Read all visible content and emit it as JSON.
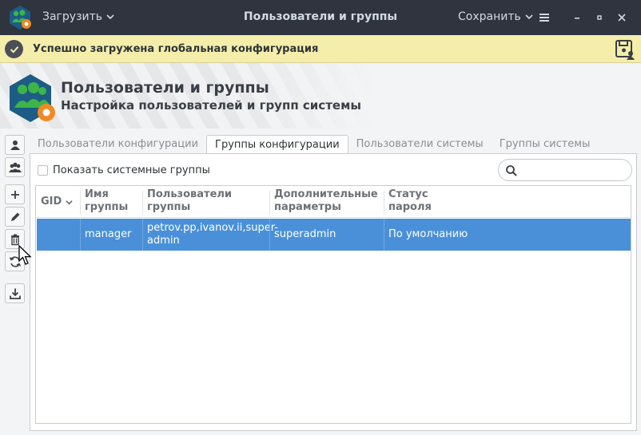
{
  "titlebar": {
    "load_label": "Загрузить",
    "title": "Пользователи и группы",
    "save_label": "Сохранить"
  },
  "notification": {
    "text": "Успешно загружена глобальная конфигурация"
  },
  "banner": {
    "title": "Пользователи и группы",
    "subtitle": "Настройка пользователей и групп системы"
  },
  "tabs": [
    {
      "label": "Пользователи конфигурации",
      "active": false
    },
    {
      "label": "Группы конфигурации",
      "active": true
    },
    {
      "label": "Пользователи системы",
      "active": false
    },
    {
      "label": "Группы системы",
      "active": false
    }
  ],
  "filter": {
    "show_system_groups_label": "Показать системные группы",
    "show_system_groups_checked": false,
    "search_value": ""
  },
  "table": {
    "columns": [
      {
        "l1": "GID",
        "l2": ""
      },
      {
        "l1": "Имя",
        "l2": "группы"
      },
      {
        "l1": "Пользователи",
        "l2": "группы"
      },
      {
        "l1": "Дополнительные",
        "l2": "параметры"
      },
      {
        "l1": "Статус",
        "l2": "пароля"
      }
    ],
    "rows": [
      {
        "gid": "",
        "name": "manager",
        "users_l1": "petrov.pp,ivanov.ii,super-",
        "users_l2": "admin",
        "params": "superadmin",
        "password_status": "По умолчанию"
      }
    ]
  },
  "colors": {
    "titlebar_bg": "#2f343f",
    "notification_bg": "#f5eeab",
    "selection": "#4a90d9",
    "accent_orange": "#f08a24",
    "logo_green": "#3cb44a",
    "logo_blue": "#1d5c84"
  }
}
